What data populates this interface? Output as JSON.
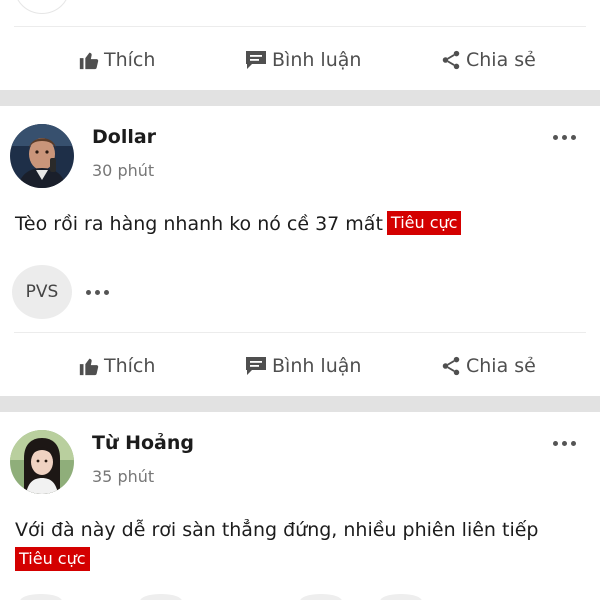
{
  "actions": {
    "like": "Thích",
    "comment": "Bình luận",
    "share": "Chia sẻ"
  },
  "posts": [
    {
      "author": "Dollar",
      "time": "30 phút",
      "content": "Tèo rồi ra hàng nhanh ko nó cề 37 mất",
      "tag": "Tiêu cực",
      "reaction_chip": "PVS"
    },
    {
      "author": "Từ Hoảng",
      "time": "35 phút",
      "content": "Với đà này dễ rơi sàn thẳng đứng, nhiều phiên liên tiếp",
      "tag": "Tiêu cực"
    }
  ],
  "colors": {
    "tag_background": "#d40000",
    "separator": "#e2e2e2",
    "action_text": "#4f4f4f"
  },
  "icons": [
    "thumbs-up-icon",
    "comment-icon",
    "share-icon",
    "more-options-icon"
  ]
}
